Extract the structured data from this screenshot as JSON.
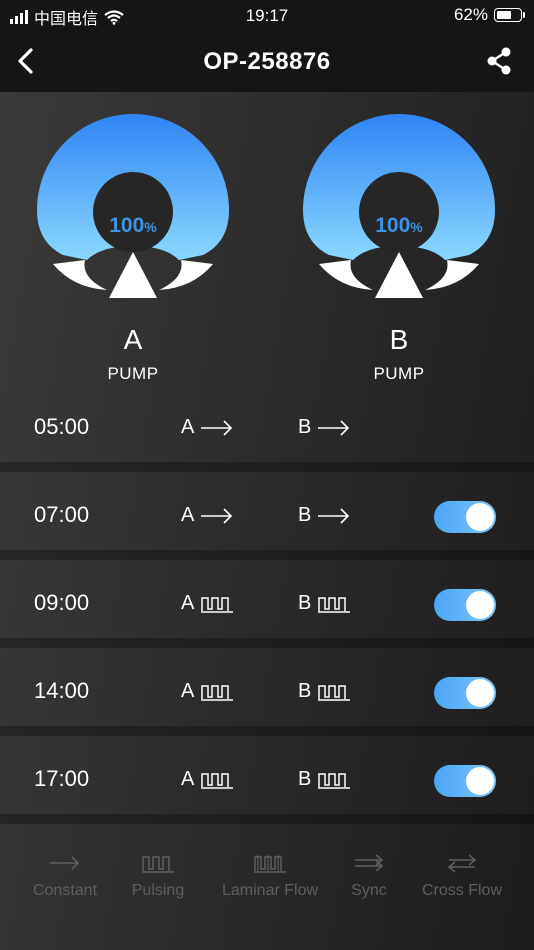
{
  "status_bar": {
    "carrier": "中国电信",
    "time": "19:17",
    "battery_text": "62%",
    "battery_level": 0.62
  },
  "nav": {
    "title": "OP-258876",
    "back_icon": "chevron-left-icon",
    "share_icon": "share-icon"
  },
  "pumps": [
    {
      "percent": "100",
      "percent_unit": "%",
      "letter": "A",
      "label": "PUMP",
      "level": 1.0
    },
    {
      "percent": "100",
      "percent_unit": "%",
      "letter": "B",
      "label": "PUMP",
      "level": 1.0
    }
  ],
  "schedules": [
    {
      "time": "05:00",
      "a_label": "A",
      "a_mode": "constant",
      "b_label": "B",
      "b_mode": "constant",
      "has_toggle": false
    },
    {
      "time": "07:00",
      "a_label": "A",
      "a_mode": "constant",
      "b_label": "B",
      "b_mode": "constant",
      "has_toggle": true,
      "enabled": true
    },
    {
      "time": "09:00",
      "a_label": "A",
      "a_mode": "pulsing",
      "b_label": "B",
      "b_mode": "pulsing",
      "has_toggle": true,
      "enabled": true
    },
    {
      "time": "14:00",
      "a_label": "A",
      "a_mode": "pulsing",
      "b_label": "B",
      "b_mode": "pulsing",
      "has_toggle": true,
      "enabled": true
    },
    {
      "time": "17:00",
      "a_label": "A",
      "a_mode": "pulsing",
      "b_label": "B",
      "b_mode": "pulsing",
      "has_toggle": true,
      "enabled": true
    }
  ],
  "modes": [
    {
      "label": "Constant",
      "icon": "arrow-right-icon"
    },
    {
      "label": "Pulsing",
      "icon": "pulse-wave-icon"
    },
    {
      "label": "Laminar Flow",
      "icon": "laminar-wave-icon"
    },
    {
      "label": "Sync",
      "icon": "double-arrow-right-icon"
    },
    {
      "label": "Cross Flow",
      "icon": "cross-arrows-icon"
    }
  ],
  "colors": {
    "accent": "#3c94e8",
    "toggle_on": "#5aaef7",
    "inactive": "#5f5f5f"
  }
}
